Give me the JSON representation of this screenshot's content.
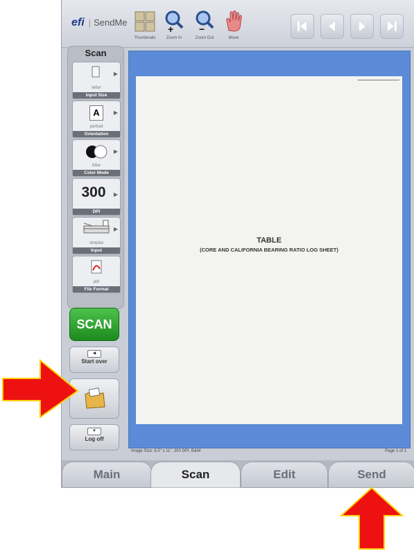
{
  "topbar": {
    "brand_logo": "efi",
    "brand_name": "SendMe",
    "tools": [
      {
        "label": "Thumbnails",
        "icon": "thumbnails-icon"
      },
      {
        "label": "Zoom In",
        "icon": "zoom-in-icon"
      },
      {
        "label": "Zoom Out",
        "icon": "zoom-out-icon"
      },
      {
        "label": "Move",
        "icon": "hand-icon"
      }
    ]
  },
  "leftpanel": {
    "title": "Scan",
    "settings": [
      {
        "value": "letter",
        "label": "Input Size"
      },
      {
        "value": "portrait",
        "label": "Orientation",
        "glyph": "A"
      },
      {
        "value": "b&w",
        "label": "Color Mode"
      },
      {
        "value": "",
        "label": "DPI",
        "glyph": "300"
      },
      {
        "value": "simplex",
        "label": "Input"
      },
      {
        "value": "pdf",
        "label": "File Format"
      }
    ],
    "scan_button": "SCAN",
    "start_over": "Start over",
    "log_off": "Log off"
  },
  "document": {
    "title": "TABLE",
    "subtitle": "(CORE AND CALIFORNIA BEARING RATIO LOG SHEET)"
  },
  "status": {
    "image_info": "Image Size: 8.5\" x 11\", 300 DPI, B&W",
    "page": "Page 1 of 1"
  },
  "tabs": [
    {
      "label": "Main",
      "active": false
    },
    {
      "label": "Scan",
      "active": true
    },
    {
      "label": "Edit",
      "active": false
    },
    {
      "label": "Send",
      "active": false
    }
  ],
  "colors": {
    "canvas_bg": "#5b8bd6",
    "scan_button": "#2a9e2a",
    "annotation_arrow": "#ee1111"
  }
}
